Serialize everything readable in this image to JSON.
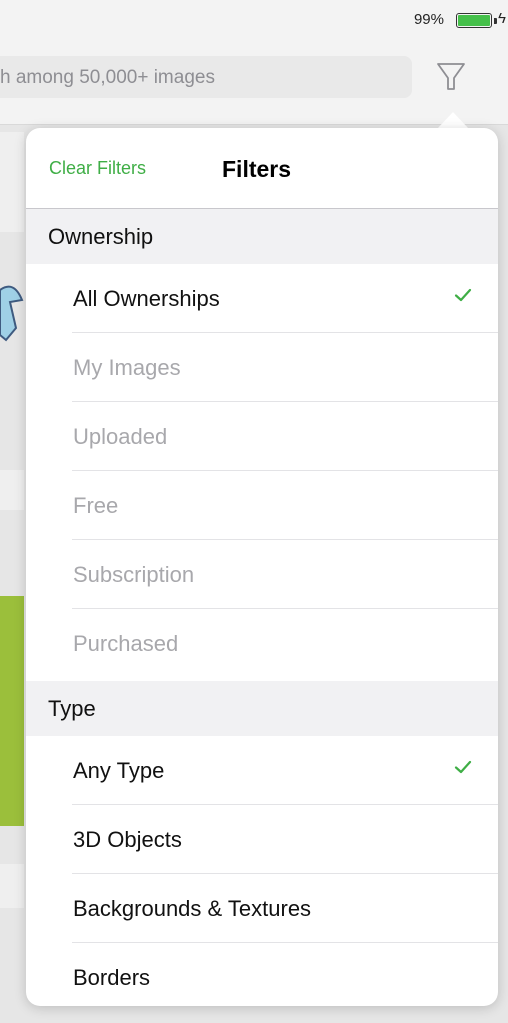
{
  "status_bar": {
    "battery_percent": "99%",
    "battery_level": 0.99,
    "charging": true
  },
  "search": {
    "placeholder": "h among 50,000+ images"
  },
  "filters": {
    "title": "Filters",
    "clear_label": "Clear Filters",
    "accent_color": "#3fae46",
    "sections": [
      {
        "header": "Ownership",
        "items": [
          {
            "label": "All Ownerships",
            "selected": true,
            "enabled": true
          },
          {
            "label": "My Images",
            "selected": false,
            "enabled": false
          },
          {
            "label": "Uploaded",
            "selected": false,
            "enabled": false
          },
          {
            "label": "Free",
            "selected": false,
            "enabled": false
          },
          {
            "label": "Subscription",
            "selected": false,
            "enabled": false
          },
          {
            "label": "Purchased",
            "selected": false,
            "enabled": false
          }
        ]
      },
      {
        "header": "Type",
        "items": [
          {
            "label": "Any Type",
            "selected": true,
            "enabled": true
          },
          {
            "label": "3D Objects",
            "selected": false,
            "enabled": true
          },
          {
            "label": "Backgrounds & Textures",
            "selected": false,
            "enabled": true
          },
          {
            "label": "Borders",
            "selected": false,
            "enabled": true
          }
        ]
      }
    ]
  }
}
